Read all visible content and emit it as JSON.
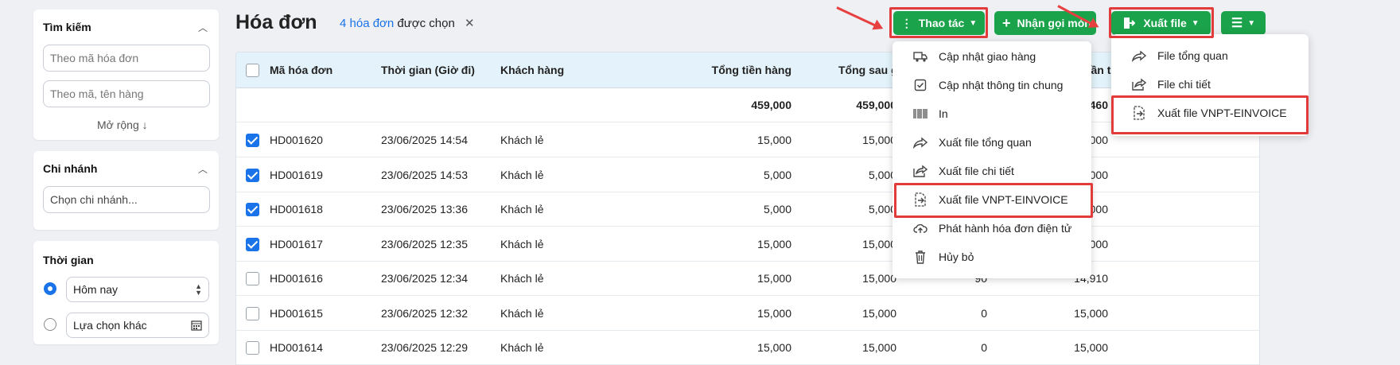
{
  "sidebar": {
    "search": {
      "title": "Tìm kiếm",
      "invoice_placeholder": "Theo mã hóa đơn",
      "product_placeholder": "Theo mã, tên hàng",
      "expand": "Mở rộng ↓"
    },
    "branch": {
      "title": "Chi nhánh",
      "placeholder": "Chọn chi nhánh..."
    },
    "time": {
      "title": "Thời gian",
      "option_today": "Hôm nay",
      "option_other": "Lựa chọn khác"
    }
  },
  "header": {
    "title": "Hóa đơn",
    "selected_count": "4 hóa đơn",
    "selected_suffix": "được chọn",
    "clear": "✕"
  },
  "toolbar": {
    "actions_label": "Thao tác",
    "receive_order_label": "Nhận gọi món",
    "export_label": "Xuất file"
  },
  "table": {
    "headers": [
      "Mã hóa đơn",
      "Thời gian (Giờ đi)",
      "Khách hàng",
      "Tổng tiền hàng",
      "Tổng sau giả",
      "",
      "Khách cần trả"
    ],
    "totals": {
      "total": "459,000",
      "after": "459,000",
      "due": "460"
    },
    "rows": [
      {
        "checked": true,
        "code": "HD001620",
        "time": "23/06/2025 14:54",
        "customer": "Khách lẻ",
        "total": "15,000",
        "after": "15,000",
        "discount": "",
        "due": "15,000"
      },
      {
        "checked": true,
        "code": "HD001619",
        "time": "23/06/2025 14:53",
        "customer": "Khách lẻ",
        "total": "5,000",
        "after": "5,000",
        "discount": "",
        "due": "5,000"
      },
      {
        "checked": true,
        "code": "HD001618",
        "time": "23/06/2025 13:36",
        "customer": "Khách lẻ",
        "total": "5,000",
        "after": "5,000",
        "discount": "",
        "due": "5,000"
      },
      {
        "checked": true,
        "code": "HD001617",
        "time": "23/06/2025 12:35",
        "customer": "Khách lẻ",
        "total": "15,000",
        "after": "15,000",
        "discount": "",
        "due": "15,000"
      },
      {
        "checked": false,
        "code": "HD001616",
        "time": "23/06/2025 12:34",
        "customer": "Khách lẻ",
        "total": "15,000",
        "after": "15,000",
        "discount": "90",
        "due": "14,910"
      },
      {
        "checked": false,
        "code": "HD001615",
        "time": "23/06/2025 12:32",
        "customer": "Khách lẻ",
        "total": "15,000",
        "after": "15,000",
        "discount": "0",
        "due": "15,000"
      },
      {
        "checked": false,
        "code": "HD001614",
        "time": "23/06/2025 12:29",
        "customer": "Khách lẻ",
        "total": "15,000",
        "after": "15,000",
        "discount": "0",
        "due": "15,000"
      }
    ]
  },
  "actions_menu": {
    "items": [
      {
        "label": "Cập nhật giao hàng",
        "icon": "delivery-truck-icon"
      },
      {
        "label": "Cập nhật thông tin chung",
        "icon": "checkbox-icon"
      },
      {
        "label": "In",
        "icon": "barcode-icon"
      },
      {
        "label": "Xuất file tổng quan",
        "icon": "share-icon"
      },
      {
        "label": "Xuất file chi tiết",
        "icon": "share-box-icon"
      },
      {
        "label": "Xuất file VNPT-EINVOICE",
        "icon": "file-export-icon"
      },
      {
        "label": "Phát hành hóa đơn điện tử",
        "icon": "cloud-upload-icon"
      },
      {
        "label": "Hủy bỏ",
        "icon": "trash-icon"
      }
    ]
  },
  "export_menu": {
    "items": [
      {
        "label": "File tổng quan",
        "icon": "share-icon"
      },
      {
        "label": "File chi tiết",
        "icon": "share-box-icon"
      },
      {
        "label": "Xuất file VNPT-EINVOICE",
        "icon": "file-export-icon"
      }
    ]
  },
  "colors": {
    "accent": "#1a73e8",
    "green": "#1aa34a",
    "highlight": "#e23b3b"
  }
}
